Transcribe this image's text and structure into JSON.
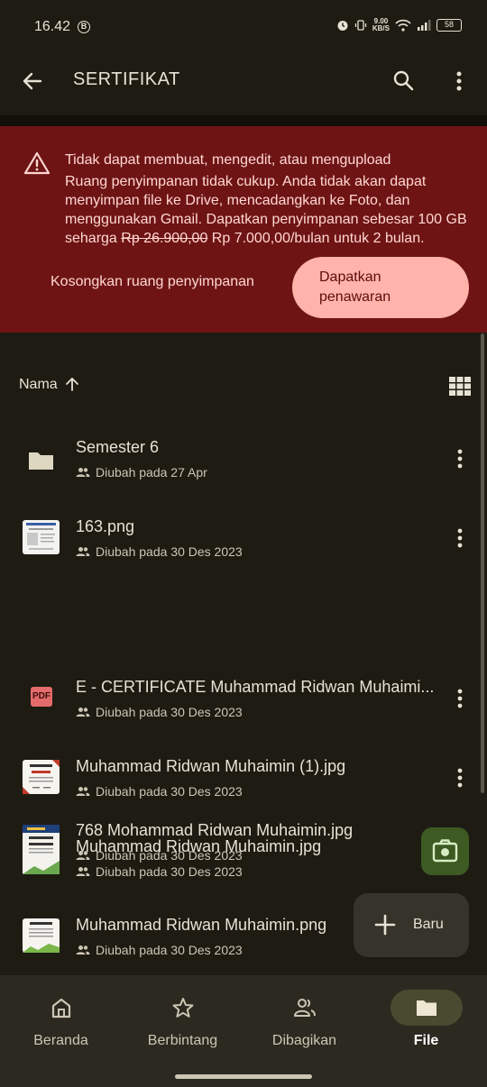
{
  "status": {
    "time": "16.42",
    "b_badge": "B",
    "net_speed_top": "9.00",
    "net_speed_unit": "KB/S",
    "battery": "58"
  },
  "app_bar": {
    "title": "SERTIFIKAT"
  },
  "banner": {
    "title": "Tidak dapat membuat, mengedit, atau mengupload",
    "body_prefix": "Ruang penyimpanan tidak cukup. Anda tidak akan dapat menyimpan file ke Drive, mencadangkan ke Foto, dan menggunakan Gmail. Dapatkan penyimpanan sebesar 100 GB seharga ",
    "old_price": "Rp 26.900,00",
    "body_suffix": " Rp 7.000,00/bulan untuk 2 bulan.",
    "free_space_label": "Kosongkan ruang penyimpanan",
    "offer_label": "Dapatkan penawaran"
  },
  "list": {
    "sort_label": "Nama",
    "items": [
      {
        "name": "Semester 6",
        "meta": "Diubah pada 27 Apr",
        "type": "folder"
      },
      {
        "name": "163.png",
        "meta": "Diubah pada 30 Des 2023",
        "type": "image"
      },
      {
        "name": "E - CERTIFICATE Muhammad Ridwan Muhaimi...",
        "meta": "Diubah pada 30 Des 2023",
        "type": "pdf",
        "badge": "PDF"
      },
      {
        "name": "Muhammad Ridwan Muhaimin (1).jpg",
        "meta": "Diubah pada 30 Des 2023",
        "type": "image"
      },
      {
        "name": "768 Mohammad Ridwan Muhaimin.jpg",
        "meta": "Diubah pada 30 Des 2023",
        "type": "image"
      },
      {
        "name": "Muhammad Ridwan Muhaimin.jpg",
        "meta": "Diubah pada 30 Des 2023",
        "type": "image"
      },
      {
        "name": "Muhammad Ridwan Muhaimin.png",
        "meta": "Diubah pada 30 Des 2023",
        "type": "image"
      }
    ]
  },
  "fab": {
    "new_label": "Baru"
  },
  "bottom_nav": {
    "items": [
      {
        "label": "Beranda",
        "icon": "home-icon"
      },
      {
        "label": "Berbintang",
        "icon": "star-icon"
      },
      {
        "label": "Dibagikan",
        "icon": "shared-icon"
      },
      {
        "label": "File",
        "icon": "folder-icon",
        "active": true
      }
    ]
  },
  "colors": {
    "background": "#1e1b13",
    "banner": "#6e1414",
    "offer_button": "#ffb3aa",
    "camera_fab": "#3c5a22",
    "nav_active": "#4a4a30"
  }
}
